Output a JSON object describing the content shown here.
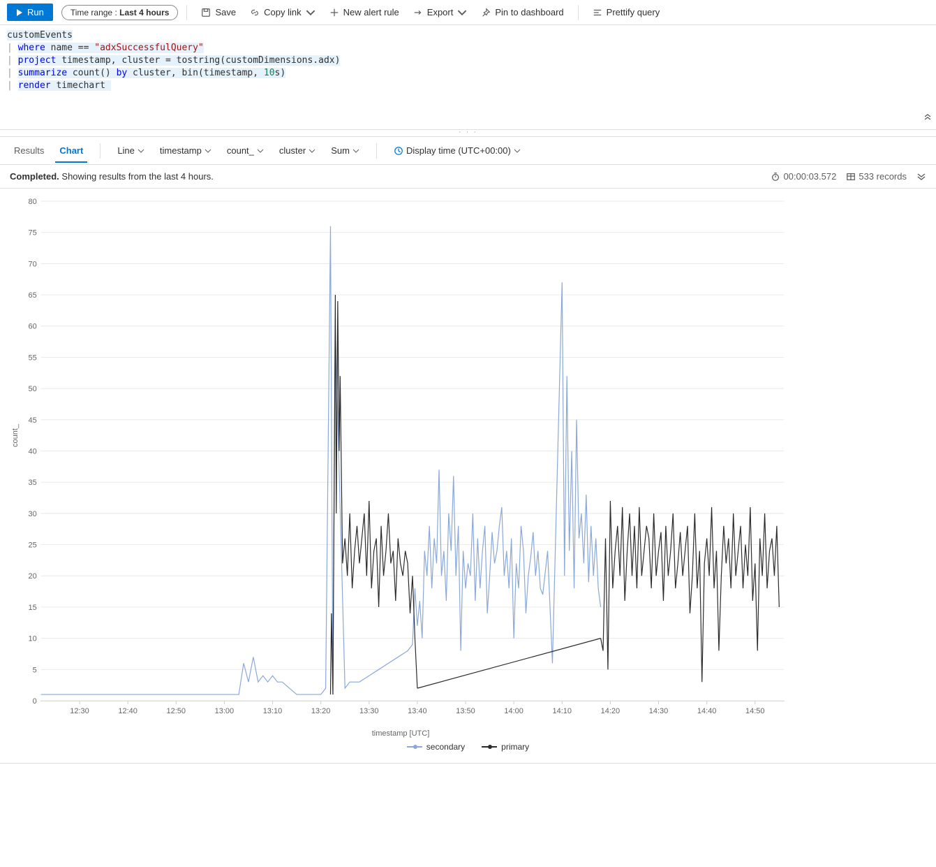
{
  "toolbar": {
    "run": "Run",
    "time_range_label": "Time range : ",
    "time_range_value": "Last 4 hours",
    "save": "Save",
    "copy_link": "Copy link",
    "new_alert": "New alert rule",
    "export": "Export",
    "pin": "Pin to dashboard",
    "prettify": "Prettify query"
  },
  "query": {
    "l1": "customEvents",
    "l2_kw": "where",
    "l2_rest_a": " name == ",
    "l2_str": "\"adxSuccessfulQuery\"",
    "l3_kw": "project",
    "l3_rest": " timestamp, cluster = tostring(customDimensions.adx)",
    "l4_kw": "summarize",
    "l4_mid": " count() ",
    "l4_by": "by",
    "l4_rest": " cluster, bin(timestamp, ",
    "l4_num": "10",
    "l4_tail": "s)",
    "l5_kw": "render",
    "l5_rest": " timechart"
  },
  "tabs": {
    "results": "Results",
    "chart": "Chart"
  },
  "controls": {
    "chart_type": "Line",
    "x": "timestamp",
    "y": "count_",
    "split": "cluster",
    "agg": "Sum",
    "tz": "Display time (UTC+00:00)"
  },
  "status": {
    "completed": "Completed.",
    "subtitle": " Showing results from the last 4 hours.",
    "duration": "00:00:03.572",
    "records": "533 records"
  },
  "chart_data": {
    "type": "line",
    "xlabel": "timestamp [UTC]",
    "ylabel": "count_",
    "ylim": [
      0,
      80
    ],
    "x_ticks": [
      "12:30",
      "12:40",
      "12:50",
      "13:00",
      "13:10",
      "13:20",
      "13:30",
      "13:40",
      "13:50",
      "14:00",
      "14:10",
      "14:20",
      "14:30",
      "14:40",
      "14:50"
    ],
    "x_range_min": "12:22",
    "x_range_max": "14:56",
    "legend": [
      "secondary",
      "primary"
    ],
    "series": [
      {
        "name": "secondary",
        "color": "#8aa8d8",
        "points": [
          [
            "12:22",
            1
          ],
          [
            "12:25",
            1
          ],
          [
            "12:30",
            1
          ],
          [
            "12:40",
            1
          ],
          [
            "12:50",
            1
          ],
          [
            "13:00",
            1
          ],
          [
            "13:03",
            1
          ],
          [
            "13:04",
            6
          ],
          [
            "13:05",
            3
          ],
          [
            "13:06",
            7
          ],
          [
            "13:07",
            3
          ],
          [
            "13:08",
            4
          ],
          [
            "13:09",
            3
          ],
          [
            "13:10",
            4
          ],
          [
            "13:11",
            3
          ],
          [
            "13:12",
            3
          ],
          [
            "13:15",
            1
          ],
          [
            "13:18",
            1
          ],
          [
            "13:20",
            1
          ],
          [
            "13:21",
            2
          ],
          [
            "13:22",
            76
          ],
          [
            "13:22.5",
            1
          ],
          [
            "13:23",
            60
          ],
          [
            "13:25",
            2
          ],
          [
            "13:26",
            3
          ],
          [
            "13:28",
            3
          ],
          [
            "13:30",
            4
          ],
          [
            "13:32",
            5
          ],
          [
            "13:34",
            6
          ],
          [
            "13:36",
            7
          ],
          [
            "13:38",
            8
          ],
          [
            "13:39",
            9
          ],
          [
            "13:39.5",
            18
          ],
          [
            "13:40",
            12
          ],
          [
            "13:40.5",
            16
          ],
          [
            "13:41",
            10
          ],
          [
            "13:41.5",
            24
          ],
          [
            "13:42",
            20
          ],
          [
            "13:42.5",
            28
          ],
          [
            "13:43",
            18
          ],
          [
            "13:43.5",
            26
          ],
          [
            "13:44",
            22
          ],
          [
            "13:44.5",
            37
          ],
          [
            "13:45",
            20
          ],
          [
            "13:45.5",
            24
          ],
          [
            "13:46",
            16
          ],
          [
            "13:46.5",
            30
          ],
          [
            "13:47",
            24
          ],
          [
            "13:47.5",
            36
          ],
          [
            "13:48",
            20
          ],
          [
            "13:48.5",
            28
          ],
          [
            "13:49",
            8
          ],
          [
            "13:49.5",
            24
          ],
          [
            "13:50",
            18
          ],
          [
            "13:50.5",
            22
          ],
          [
            "13:51",
            20
          ],
          [
            "13:51.5",
            30
          ],
          [
            "13:52",
            16
          ],
          [
            "13:52.5",
            26
          ],
          [
            "13:53",
            18
          ],
          [
            "13:53.5",
            24
          ],
          [
            "13:54",
            28
          ],
          [
            "13:54.5",
            14
          ],
          [
            "13:55",
            20
          ],
          [
            "13:55.5",
            27
          ],
          [
            "13:56",
            22
          ],
          [
            "13:56.5",
            24
          ],
          [
            "13:57",
            28
          ],
          [
            "13:57.5",
            31
          ],
          [
            "13:58",
            20
          ],
          [
            "13:58.5",
            24
          ],
          [
            "13:59",
            18
          ],
          [
            "13:59.5",
            26
          ],
          [
            "14:00",
            10
          ],
          [
            "14:00.5",
            22
          ],
          [
            "14:01",
            18
          ],
          [
            "14:01.5",
            28
          ],
          [
            "14:02",
            24
          ],
          [
            "14:02.5",
            14
          ],
          [
            "14:03",
            20
          ],
          [
            "14:03.5",
            23
          ],
          [
            "14:04",
            27
          ],
          [
            "14:04.5",
            20
          ],
          [
            "14:05",
            24
          ],
          [
            "14:05.5",
            18
          ],
          [
            "14:06",
            17
          ],
          [
            "14:07",
            24
          ],
          [
            "14:08",
            6
          ],
          [
            "14:10",
            67
          ],
          [
            "14:10.5",
            20
          ],
          [
            "14:11",
            52
          ],
          [
            "14:11.5",
            24
          ],
          [
            "14:12",
            40
          ],
          [
            "14:12.5",
            18
          ],
          [
            "14:13",
            45
          ],
          [
            "14:13.5",
            26
          ],
          [
            "14:14",
            30
          ],
          [
            "14:14.5",
            22
          ],
          [
            "14:15",
            33
          ],
          [
            "14:15.5",
            19
          ],
          [
            "14:16",
            28
          ],
          [
            "14:16.5",
            20
          ],
          [
            "14:17",
            26
          ],
          [
            "14:17.5",
            18
          ],
          [
            "14:18",
            15
          ]
        ]
      },
      {
        "name": "primary",
        "color": "#2b2b2b",
        "points": [
          [
            "13:22",
            1
          ],
          [
            "13:22.2",
            14
          ],
          [
            "13:22.5",
            1
          ],
          [
            "13:23",
            65
          ],
          [
            "13:23.2",
            30
          ],
          [
            "13:23.5",
            64
          ],
          [
            "13:23.8",
            40
          ],
          [
            "13:24",
            52
          ],
          [
            "13:24.5",
            22
          ],
          [
            "13:25",
            26
          ],
          [
            "13:25.5",
            20
          ],
          [
            "13:26",
            30
          ],
          [
            "13:26.5",
            18
          ],
          [
            "13:27",
            24
          ],
          [
            "13:27.5",
            28
          ],
          [
            "13:28",
            22
          ],
          [
            "13:28.5",
            26
          ],
          [
            "13:29",
            30
          ],
          [
            "13:29.5",
            20
          ],
          [
            "13:30",
            32
          ],
          [
            "13:30.5",
            18
          ],
          [
            "13:31",
            24
          ],
          [
            "13:31.5",
            26
          ],
          [
            "13:32",
            15
          ],
          [
            "13:32.5",
            28
          ],
          [
            "13:33",
            20
          ],
          [
            "13:33.5",
            24
          ],
          [
            "13:34",
            30
          ],
          [
            "13:34.5",
            22
          ],
          [
            "13:35",
            24
          ],
          [
            "13:35.5",
            16
          ],
          [
            "13:36",
            26
          ],
          [
            "13:36.5",
            22
          ],
          [
            "13:37",
            20
          ],
          [
            "13:37.5",
            24
          ],
          [
            "13:38",
            22
          ],
          [
            "13:38.5",
            14
          ],
          [
            "13:39",
            20
          ],
          [
            "13:39.5",
            10
          ],
          [
            "13:40",
            2
          ],
          [
            "14:18",
            10
          ],
          [
            "14:18.5",
            8
          ],
          [
            "14:19",
            26
          ],
          [
            "14:19.5",
            5
          ],
          [
            "14:20",
            32
          ],
          [
            "14:20.5",
            18
          ],
          [
            "14:21",
            24
          ],
          [
            "14:21.5",
            28
          ],
          [
            "14:22",
            20
          ],
          [
            "14:22.5",
            31
          ],
          [
            "14:23",
            16
          ],
          [
            "14:23.5",
            24
          ],
          [
            "14:24",
            30
          ],
          [
            "14:24.5",
            20
          ],
          [
            "14:25",
            28
          ],
          [
            "14:25.5",
            18
          ],
          [
            "14:26",
            31
          ],
          [
            "14:26.5",
            20
          ],
          [
            "14:27",
            24
          ],
          [
            "14:27.5",
            28
          ],
          [
            "14:28",
            26
          ],
          [
            "14:28.5",
            18
          ],
          [
            "14:29",
            30
          ],
          [
            "14:29.5",
            20
          ],
          [
            "14:30",
            24
          ],
          [
            "14:30.5",
            27
          ],
          [
            "14:31",
            16
          ],
          [
            "14:31.5",
            28
          ],
          [
            "14:32",
            20
          ],
          [
            "14:32.5",
            24
          ],
          [
            "14:33",
            30
          ],
          [
            "14:33.5",
            18
          ],
          [
            "14:34",
            22
          ],
          [
            "14:34.5",
            27
          ],
          [
            "14:35",
            20
          ],
          [
            "14:35.5",
            24
          ],
          [
            "14:36",
            28
          ],
          [
            "14:36.5",
            14
          ],
          [
            "14:37",
            20
          ],
          [
            "14:37.5",
            30
          ],
          [
            "14:38",
            18
          ],
          [
            "14:38.5",
            24
          ],
          [
            "14:39",
            3
          ],
          [
            "14:39.5",
            22
          ],
          [
            "14:40",
            26
          ],
          [
            "14:40.5",
            20
          ],
          [
            "14:41",
            31
          ],
          [
            "14:41.5",
            18
          ],
          [
            "14:42",
            24
          ],
          [
            "14:42.5",
            8
          ],
          [
            "14:43",
            20
          ],
          [
            "14:43.5",
            28
          ],
          [
            "14:44",
            22
          ],
          [
            "14:44.5",
            26
          ],
          [
            "14:45",
            18
          ],
          [
            "14:45.5",
            30
          ],
          [
            "14:46",
            20
          ],
          [
            "14:46.5",
            24
          ],
          [
            "14:47",
            28
          ],
          [
            "14:47.5",
            18
          ],
          [
            "14:48",
            25
          ],
          [
            "14:48.5",
            20
          ],
          [
            "14:49",
            31
          ],
          [
            "14:49.5",
            16
          ],
          [
            "14:50",
            22
          ],
          [
            "14:50.5",
            8
          ],
          [
            "14:51",
            26
          ],
          [
            "14:51.5",
            20
          ],
          [
            "14:52",
            30
          ],
          [
            "14:52.5",
            18
          ],
          [
            "14:53",
            24
          ],
          [
            "14:53.5",
            26
          ],
          [
            "14:54",
            20
          ],
          [
            "14:54.5",
            28
          ],
          [
            "14:55",
            15
          ]
        ]
      }
    ]
  }
}
